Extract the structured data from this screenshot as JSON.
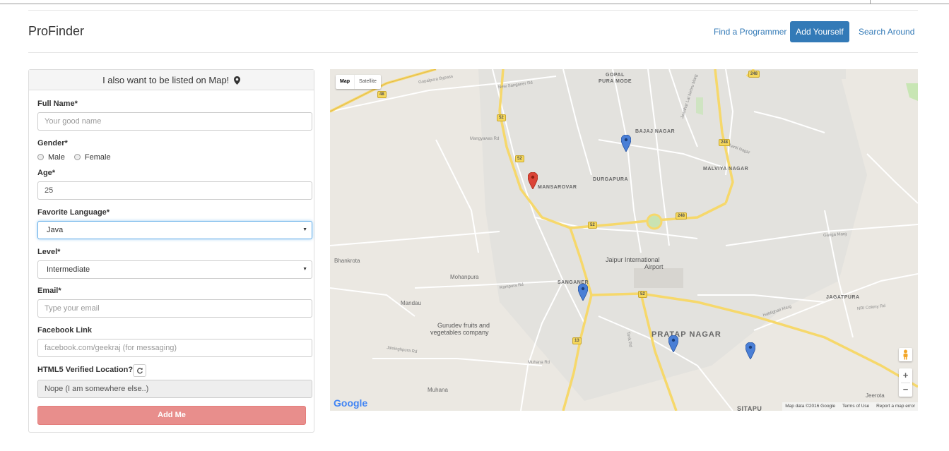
{
  "app": {
    "brand": "ProFinder"
  },
  "nav": {
    "find": "Find a Programmer",
    "add": "Add Yourself",
    "search": "Search Around"
  },
  "form": {
    "heading": "I also want to be listed on Map!",
    "full_name_label": "Full Name*",
    "full_name_placeholder": "Your good name",
    "gender_label": "Gender*",
    "gender_options": [
      "Male",
      "Female"
    ],
    "age_label": "Age*",
    "age_value": "25",
    "language_label": "Favorite Language*",
    "language_value": "Java",
    "level_label": "Level*",
    "level_value": "Intermediate",
    "email_label": "Email*",
    "email_placeholder": "Type your email",
    "facebook_label": "Facebook Link",
    "facebook_placeholder": "facebook.com/geekraj (for messaging)",
    "location_label": "HTML5 Verified Location?",
    "location_value": "Nope (I am somewhere else..)",
    "submit_label": "Add Me"
  },
  "map": {
    "type_map": "Map",
    "type_satellite": "Satellite",
    "logo": "Google",
    "attribution": "Map data ©2016 Google",
    "terms": "Terms of Use",
    "report": "Report a map error",
    "zoom_in": "+",
    "zoom_out": "−",
    "places": {
      "gopal": "GOPAL",
      "pura_mode": "PURA MODE",
      "bajaj_nagar": "BAJAJ NAGAR",
      "malviya_nagar": "MALVIYA NAGAR",
      "mansarovar": "MANSAROVAR",
      "durgapura": "DURGAPURA",
      "bhankrota": "Bhankrota",
      "mohanpura": "Mohanpura",
      "mandau": "Mandau",
      "airport_1": "Jaipur International",
      "airport_2": "Airport",
      "sanganer": "SANGANER",
      "gurudev_1": "Gurudev fruits and",
      "gurudev_2": "vegetables company",
      "pratap_nagar": "PRATAP NAGAR",
      "jagatpura": "JAGATPURA",
      "muhana": "Muhana",
      "jeerota": "Jeerota",
      "sitapu": "SITAPU"
    },
    "roads": {
      "gopalpura_bypass": "Gopalpura Bypass",
      "new_sanganer_rd": "New Sanganer Rd",
      "mangyawas_rd": "Mangyawas Rd",
      "muhana_rd": "Muhana Rd",
      "ganga_marg": "Ganga Marg",
      "rampura_rd": "Rampura Rd",
      "jaisinghpura_rd": "Jaisinghpura Rd",
      "nri_colony_rd": "NRI Colony Rd",
      "haldighati_marg": "Haldighati Marg",
      "tonk_rd": "Tonk Rd",
      "jln_marg": "Jawahar Lal Nehru Marg",
      "shanti_nagar": "Shanti Nagar"
    },
    "shields": [
      "248",
      "52",
      "52",
      "248",
      "48",
      "52",
      "248",
      "52",
      "13"
    ],
    "pins": [
      {
        "color": "#db4437",
        "name": "Mansarovar"
      },
      {
        "color": "#4a7fd6",
        "name": "Bajaj Nagar"
      },
      {
        "color": "#4a7fd6",
        "name": "Sanganer"
      },
      {
        "color": "#4a7fd6",
        "name": "Pratap Nagar"
      },
      {
        "color": "#4a7fd6",
        "name": "Jagatpura"
      }
    ]
  }
}
